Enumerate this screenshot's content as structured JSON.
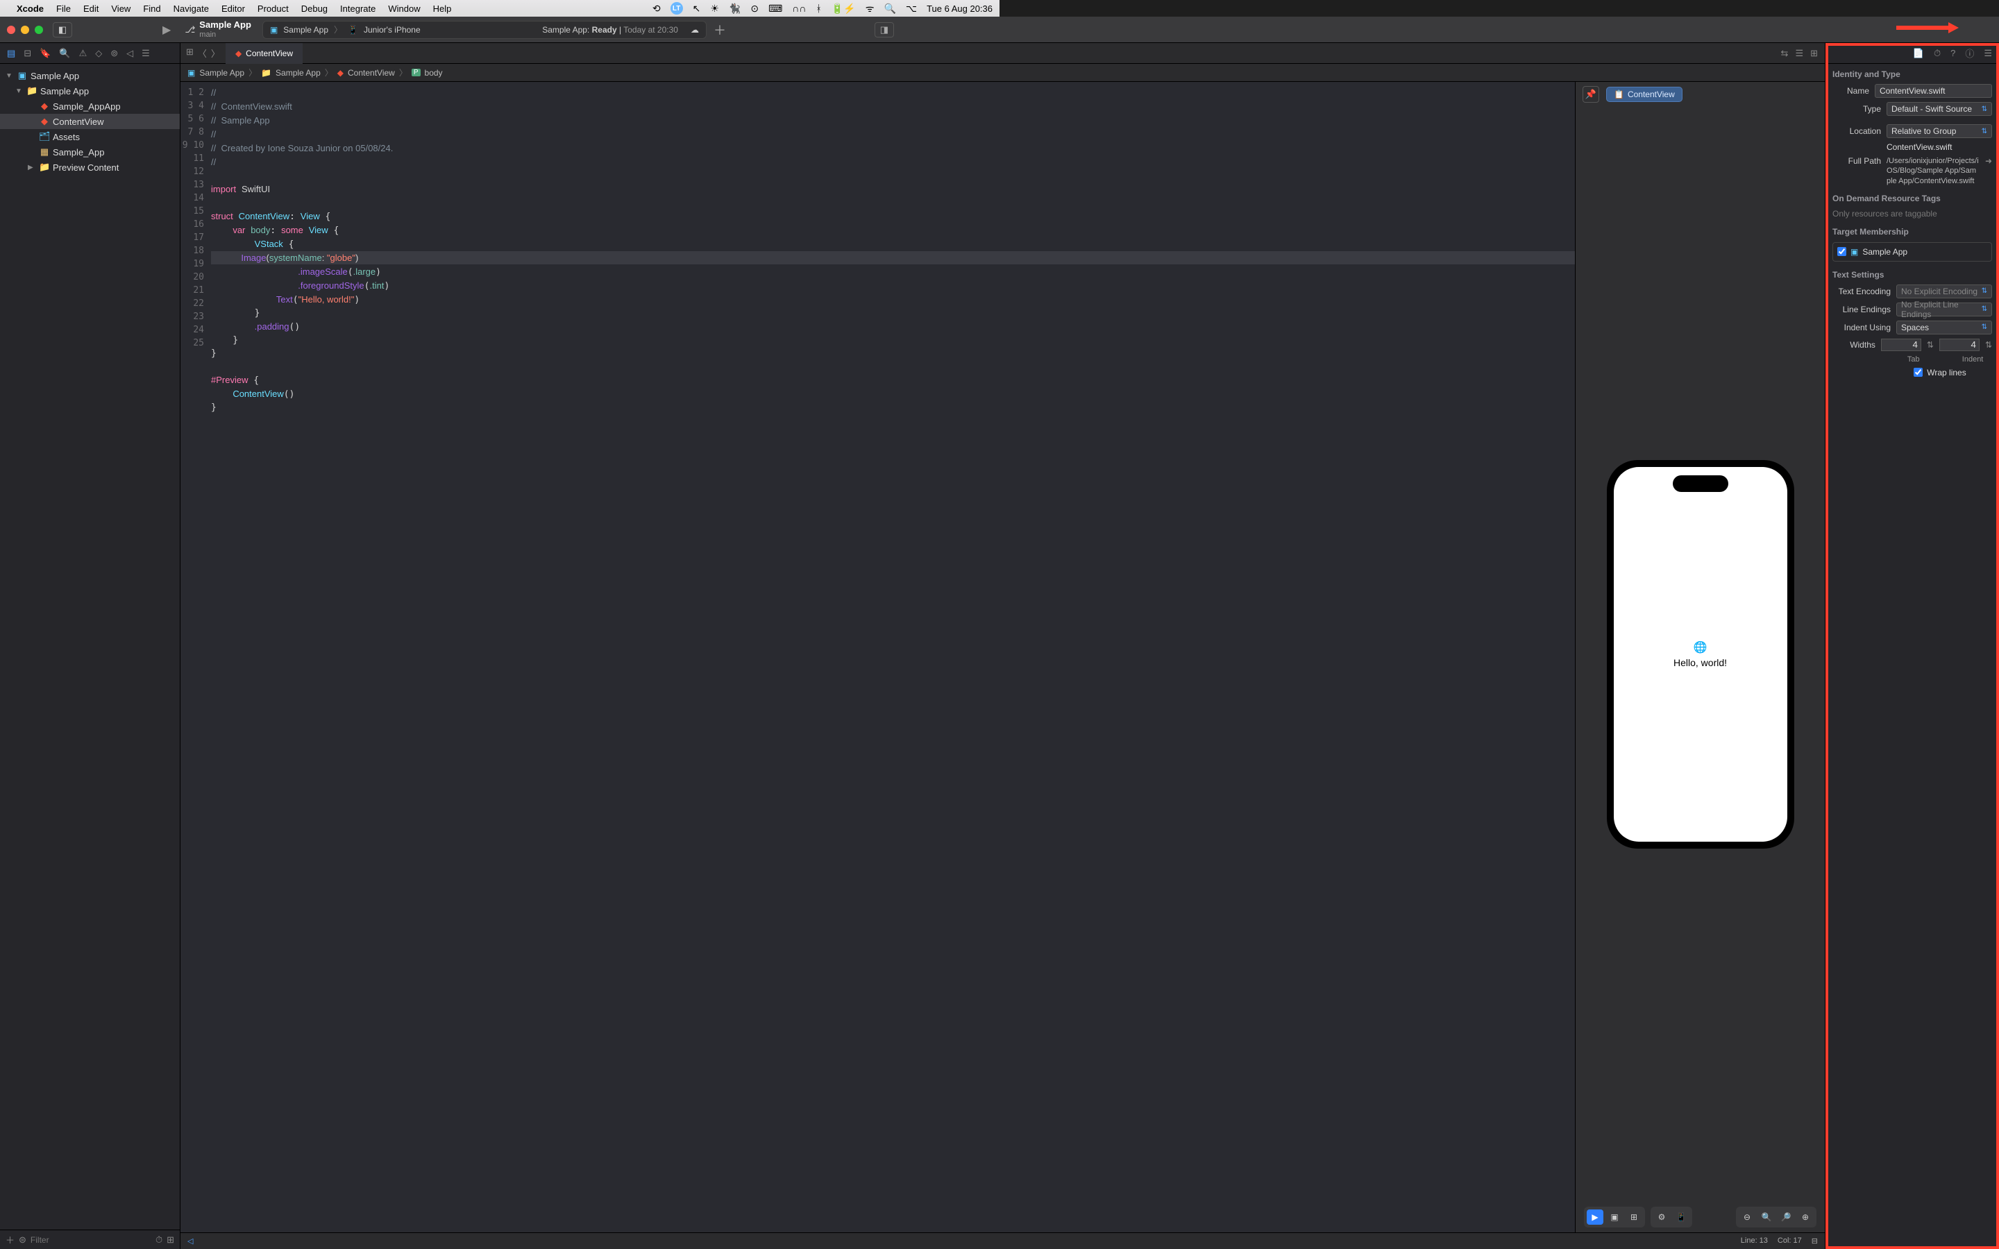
{
  "menubar": {
    "app": "Xcode",
    "items": [
      "File",
      "Edit",
      "View",
      "Find",
      "Navigate",
      "Editor",
      "Product",
      "Debug",
      "Integrate",
      "Window",
      "Help"
    ],
    "clock": "Tue 6 Aug  20:36"
  },
  "titlebar": {
    "project": "Sample App",
    "branch": "main",
    "scheme_app": "Sample App",
    "scheme_device": "Junior's iPhone",
    "status_prefix": "Sample App: ",
    "status_ready": "Ready",
    "status_sep": " | ",
    "status_time": "Today at 20:30"
  },
  "nav": {
    "root": "Sample App",
    "group": "Sample App",
    "items": [
      "Sample_AppApp",
      "ContentView",
      "Assets",
      "Sample_App",
      "Preview Content"
    ],
    "selected": "ContentView",
    "filter_placeholder": "Filter"
  },
  "tab": {
    "name": "ContentView"
  },
  "jumpbar": [
    "Sample App",
    "Sample App",
    "ContentView",
    "body"
  ],
  "code": {
    "lines": 25,
    "l1": "//",
    "l2": "//  ContentView.swift",
    "l3": "//  Sample App",
    "l4": "//",
    "l5": "//  Created by Ione Souza Junior on 05/08/24.",
    "l6": "//",
    "import_kw": "import",
    "import_mod": "SwiftUI",
    "struct_kw": "struct",
    "struct_name": "ContentView",
    "view": "View",
    "var_kw": "var",
    "body_name": "body",
    "some_kw": "some",
    "vstack": "VStack",
    "image_fn": "Image",
    "sysname_lbl": "systemName",
    "globe": "\"globe\"",
    "imgscale": ".imageScale",
    "large": ".large",
    "fgstyle": ".foregroundStyle",
    "tint": ".tint",
    "text_fn": "Text",
    "hello": "\"Hello, world!\"",
    "padding": ".padding",
    "preview": "#Preview",
    "cv_call": "ContentView"
  },
  "preview": {
    "chip": "ContentView",
    "hello": "Hello, world!"
  },
  "footer": {
    "line": "Line: 13",
    "col": "Col: 17"
  },
  "inspector": {
    "identity_title": "Identity and Type",
    "name_lbl": "Name",
    "name_val": "ContentView.swift",
    "type_lbl": "Type",
    "type_val": "Default - Swift Source",
    "loc_lbl": "Location",
    "loc_val": "Relative to Group",
    "loc_path": "ContentView.swift",
    "full_lbl": "Full Path",
    "full_val": "/Users/ionixjunior/Projects/iOS/Blog/Sample App/Sample App/ContentView.swift",
    "odr_title": "On Demand Resource Tags",
    "odr_placeholder": "Only resources are taggable",
    "target_title": "Target Membership",
    "target_name": "Sample App",
    "text_title": "Text Settings",
    "enc_lbl": "Text Encoding",
    "enc_val": "No Explicit Encoding",
    "le_lbl": "Line Endings",
    "le_val": "No Explicit Line Endings",
    "indent_lbl": "Indent Using",
    "indent_val": "Spaces",
    "widths_lbl": "Widths",
    "tab_width": "4",
    "indent_width": "4",
    "tab_sub": "Tab",
    "indent_sub": "Indent",
    "wrap_lbl": "Wrap lines"
  }
}
